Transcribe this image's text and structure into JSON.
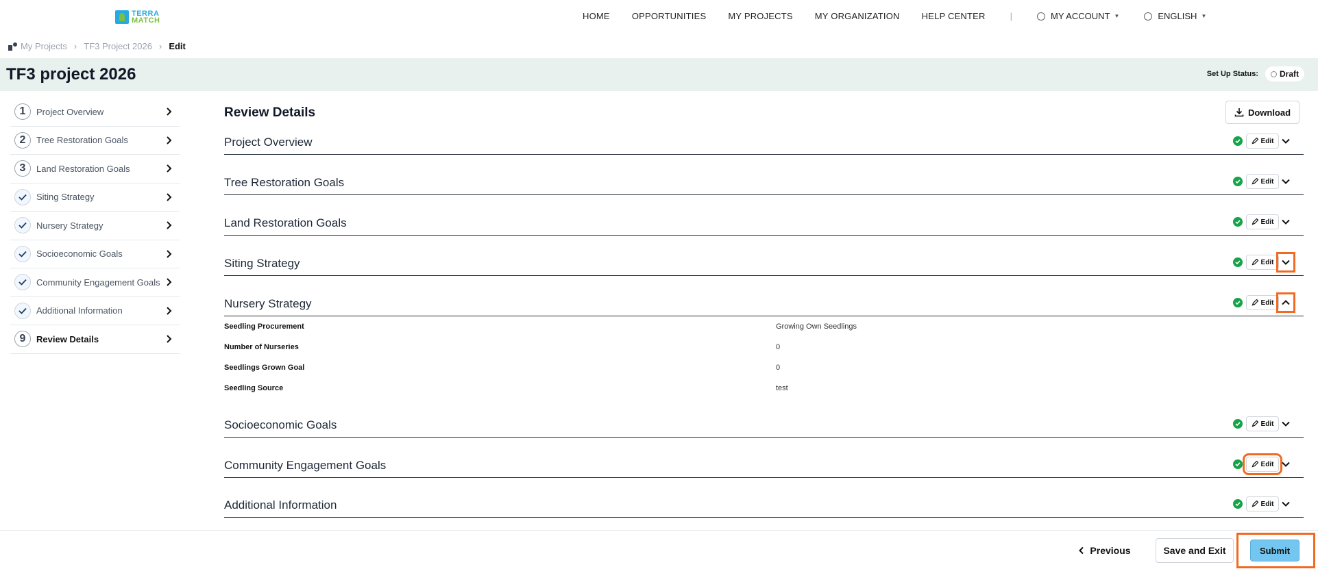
{
  "logo": {
    "line1": "TERRA",
    "line2": "MATCH"
  },
  "nav": {
    "links": [
      "HOME",
      "OPPORTUNITIES",
      "MY PROJECTS",
      "MY ORGANIZATION",
      "HELP CENTER"
    ],
    "separator": "|",
    "account": "MY ACCOUNT",
    "language": "ENGLISH"
  },
  "breadcrumb": {
    "items": [
      "My Projects",
      "TF3 Project 2026"
    ],
    "current": "Edit"
  },
  "page": {
    "title": "TF3 project 2026",
    "setup_label": "Set Up Status:",
    "status": "Draft"
  },
  "sidebar": {
    "steps": [
      {
        "marker": "1",
        "label": "Project Overview"
      },
      {
        "marker": "2",
        "label": "Tree Restoration Goals"
      },
      {
        "marker": "3",
        "label": "Land Restoration Goals"
      },
      {
        "marker": "check",
        "label": "Siting Strategy"
      },
      {
        "marker": "check",
        "label": "Nursery Strategy"
      },
      {
        "marker": "check",
        "label": "Socioeconomic Goals"
      },
      {
        "marker": "check",
        "label": "Community Engagement Goals"
      },
      {
        "marker": "check",
        "label": "Additional Information"
      },
      {
        "marker": "9",
        "label": "Review Details"
      }
    ]
  },
  "review": {
    "title": "Review Details",
    "download_label": "Download",
    "edit_label": "Edit",
    "sections": [
      {
        "title": "Project Overview",
        "expanded": false
      },
      {
        "title": "Tree Restoration Goals",
        "expanded": false
      },
      {
        "title": "Land Restoration Goals",
        "expanded": false
      },
      {
        "title": "Siting Strategy",
        "expanded": false
      },
      {
        "title": "Nursery Strategy",
        "expanded": true
      },
      {
        "title": "Socioeconomic Goals",
        "expanded": false
      },
      {
        "title": "Community Engagement Goals",
        "expanded": false
      },
      {
        "title": "Additional Information",
        "expanded": false
      }
    ],
    "nursery_details": [
      {
        "label": "Seedling Procurement",
        "value": "Growing Own Seedlings"
      },
      {
        "label": "Number of Nurseries",
        "value": "0"
      },
      {
        "label": "Seedlings Grown Goal",
        "value": "0"
      },
      {
        "label": "Seedling Source",
        "value": "test"
      }
    ]
  },
  "footer": {
    "previous": "Previous",
    "save_exit": "Save and Exit",
    "submit": "Submit"
  },
  "colors": {
    "accent": "#72c6ef",
    "success": "#16a34a",
    "highlight": "#f26a21",
    "title_bar_bg": "#e8f1ee"
  }
}
